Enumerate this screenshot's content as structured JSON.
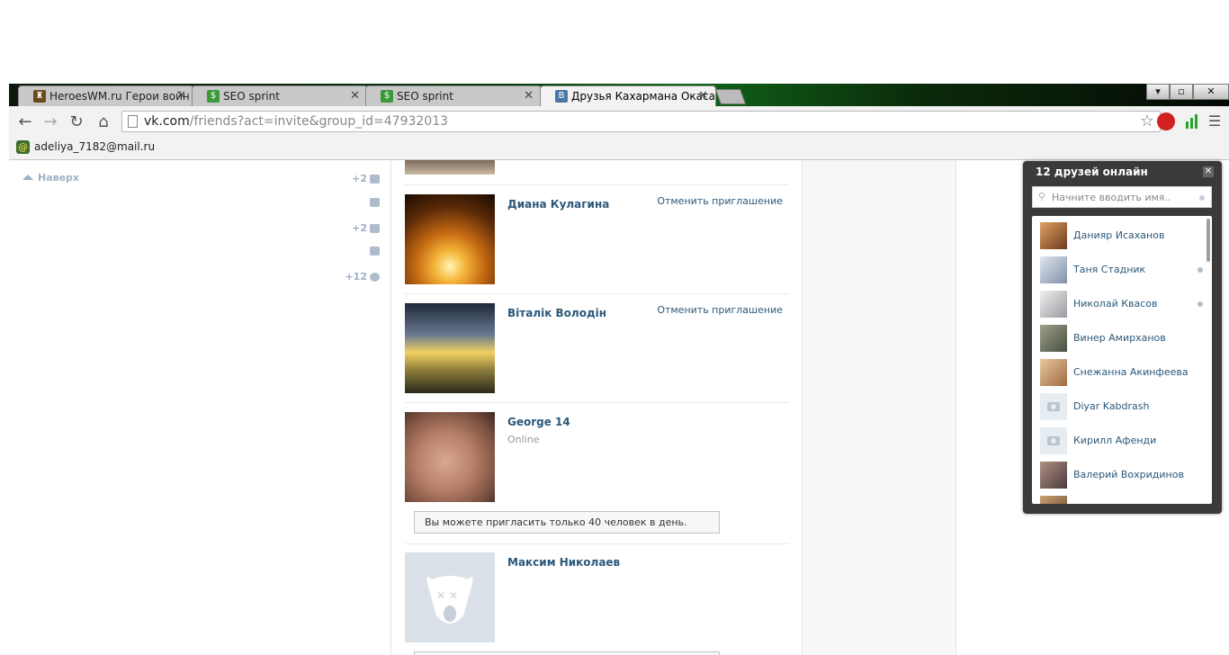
{
  "browser": {
    "tabs": [
      {
        "title": "HeroesWM.ru Герои войн",
        "icon": "helmet-icon",
        "color": "#6b4a1a"
      },
      {
        "title": "SEO sprint",
        "icon": "dollar-s-icon",
        "color": "#3a9a3a"
      },
      {
        "title": "SEO sprint",
        "icon": "dollar-s-icon",
        "color": "#3a9a3a"
      },
      {
        "title": "Друзья Кахармана Окаса",
        "icon": "vk-icon",
        "color": "#4a76a8"
      }
    ],
    "address": {
      "host": "vk.com",
      "path": "/friends?act=invite&group_id=47932013"
    },
    "bookmark": "adeliya_7182@mail.ru",
    "window_controls": {
      "minimize": "▾",
      "restore": "▫",
      "close": "✕"
    }
  },
  "sidebar": {
    "up_label": "Наверх",
    "counters": [
      {
        "value": "+2",
        "icon": "friend-icon"
      },
      {
        "value": "",
        "icon": "mail-icon"
      },
      {
        "value": "+2",
        "icon": "groups-icon"
      },
      {
        "value": "",
        "icon": "comment-icon"
      },
      {
        "value": "+12",
        "icon": "settings-icon"
      }
    ]
  },
  "friends": [
    {
      "name": "Диана Кулагина",
      "action": "Отменить приглашение",
      "status": ""
    },
    {
      "name": "Віталік Володін",
      "action": "Отменить приглашение",
      "status": ""
    },
    {
      "name": "George 14",
      "action": "",
      "status": "Online"
    },
    {
      "name": "Максим Николаев",
      "action": "",
      "status": ""
    }
  ],
  "notice": "Вы можете пригласить только 40 человек в день.",
  "online": {
    "title": "12 друзей онлайн",
    "search_placeholder": "Начните вводить имя..",
    "items": [
      {
        "name": "Данияр Исаханов",
        "mobile": false,
        "avatar": "photo"
      },
      {
        "name": "Таня Стадник",
        "mobile": true,
        "avatar": "photo"
      },
      {
        "name": "Николай Квасов",
        "mobile": true,
        "avatar": "photo"
      },
      {
        "name": "Винер Амирханов",
        "mobile": false,
        "avatar": "photo"
      },
      {
        "name": "Снежанна Акинфеева",
        "mobile": false,
        "avatar": "photo"
      },
      {
        "name": "Diyar Kabdrash",
        "mobile": false,
        "avatar": "camera"
      },
      {
        "name": "Кирилл Афенди",
        "mobile": false,
        "avatar": "camera"
      },
      {
        "name": "Валерий Вохридинов",
        "mobile": false,
        "avatar": "photo"
      }
    ]
  }
}
